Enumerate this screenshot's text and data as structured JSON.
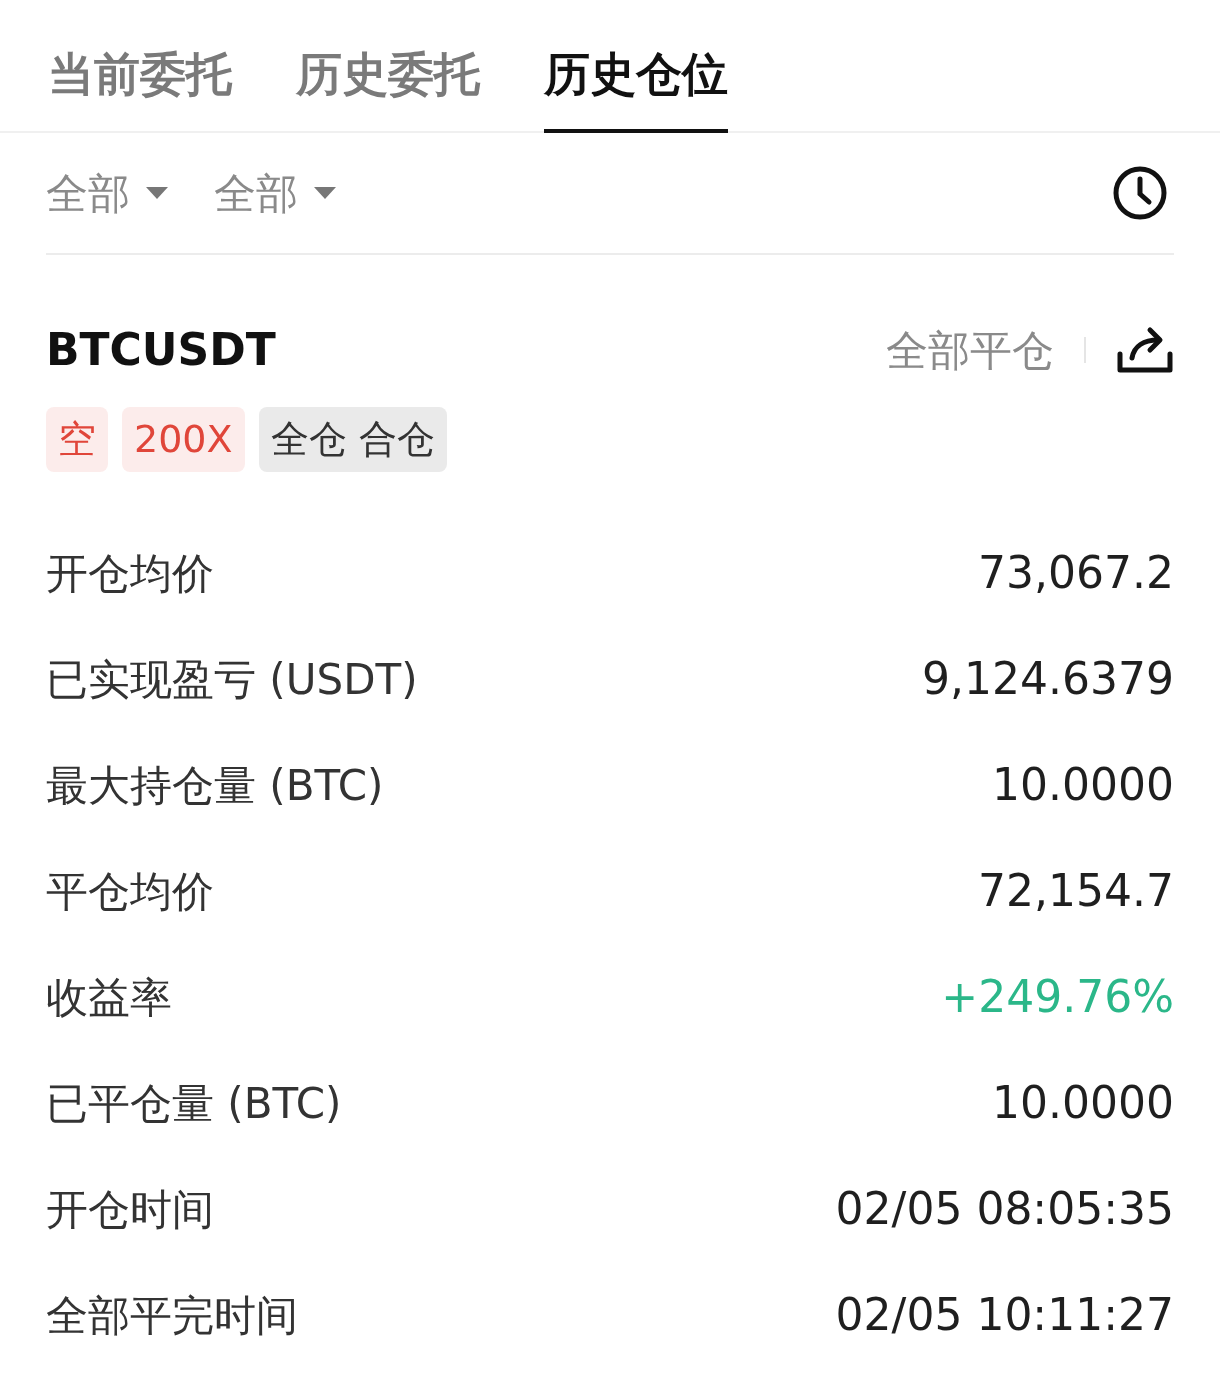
{
  "tabs": [
    {
      "label": "当前委托",
      "selected": false
    },
    {
      "label": "历史委托",
      "selected": false
    },
    {
      "label": "历史仓位",
      "selected": true
    }
  ],
  "filters": [
    {
      "label": "全部"
    },
    {
      "label": "全部"
    }
  ],
  "position": {
    "symbol": "BTCUSDT",
    "close_all": "全部平仓",
    "tags": [
      {
        "label": "空",
        "color": "#e0463a"
      },
      {
        "label": "200X",
        "color": "#e0463a"
      },
      {
        "label": "全仓 合仓",
        "color": "#333333"
      }
    ],
    "rows": [
      {
        "label": "开仓均价",
        "value": "73,067.2",
        "color": "#1f1f1f"
      },
      {
        "label": "已实现盈亏 (USDT)",
        "value": "9,124.6379",
        "color": "#1f1f1f"
      },
      {
        "label": "最大持仓量 (BTC)",
        "value": "10.0000",
        "color": "#1f1f1f"
      },
      {
        "label": "平仓均价",
        "value": "72,154.7",
        "color": "#1f1f1f"
      },
      {
        "label": "收益率",
        "value": "+249.76%",
        "color": "#2bb789"
      },
      {
        "label": "已平仓量 (BTC)",
        "value": "10.0000",
        "color": "#1f1f1f"
      },
      {
        "label": "开仓时间",
        "value": "02/05 08:05:35",
        "color": "#1f1f1f"
      },
      {
        "label": "全部平完时间",
        "value": "02/05 10:11:27",
        "color": "#1f1f1f"
      }
    ]
  }
}
